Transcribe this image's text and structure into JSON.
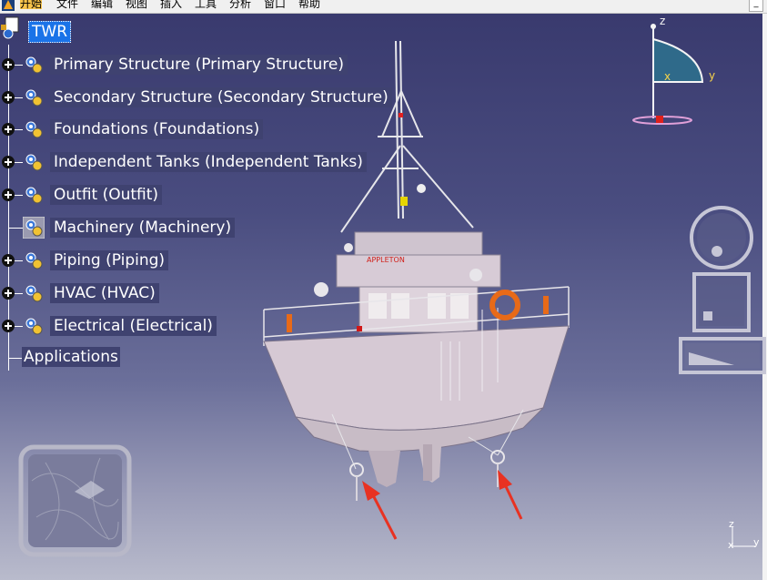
{
  "menubar": {
    "items": [
      "开始",
      "文件",
      "编辑",
      "视图",
      "插入",
      "工具",
      "分析",
      "窗口",
      "帮助"
    ],
    "active_index": 0,
    "minimize_glyph": "_"
  },
  "tree": {
    "root": {
      "label": "TWR",
      "icon": "product-icon"
    },
    "nodes": [
      {
        "label": "Primary Structure (Primary Structure)",
        "icon": "gears-icon"
      },
      {
        "label": "Secondary Structure (Secondary Structure)",
        "icon": "gears-icon"
      },
      {
        "label": "Foundations (Foundations)",
        "icon": "gears-icon"
      },
      {
        "label": "Independent Tanks (Independent Tanks)",
        "icon": "gears-icon"
      },
      {
        "label": "Outfit (Outfit)",
        "icon": "gears-icon"
      },
      {
        "label": "Machinery (Machinery)",
        "icon": "gears-selected-icon"
      },
      {
        "label": "Piping (Piping)",
        "icon": "gears-icon"
      },
      {
        "label": "HVAC (HVAC)",
        "icon": "gears-icon"
      },
      {
        "label": "Electrical (Electrical)",
        "icon": "gears-icon"
      }
    ],
    "applications": "Applications"
  },
  "model": {
    "ship_name": "APPLETON"
  },
  "compass": {
    "x": "x",
    "y": "y",
    "z": "z"
  },
  "axis_triad": {
    "x": "x",
    "y": "y",
    "z": "z"
  },
  "colors": {
    "background_top": "#393a6e",
    "background_bottom": "#b9bbcc",
    "hull": "#d9cdd6",
    "arrow": "#e83222",
    "compass": "#2f6a8a",
    "selection": "#1a73e8"
  }
}
